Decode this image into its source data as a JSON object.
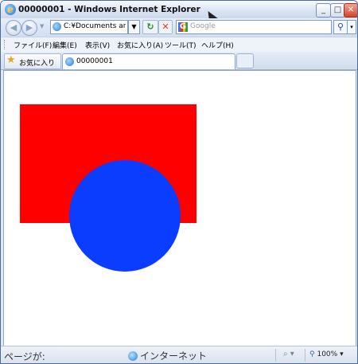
{
  "window": {
    "title": "00000001 - Windows Internet Explorer",
    "minimize_glyph": "_",
    "maximize_glyph": "□",
    "close_glyph": "✕"
  },
  "address_bar": {
    "url": "C:¥Documents and S",
    "dropdown_glyph": "▼",
    "refresh_glyph": "↻",
    "stop_glyph": "✕",
    "back_glyph": "◀",
    "forward_glyph": "▶"
  },
  "search": {
    "placeholder": "Google",
    "engine_logo_letter": "G",
    "button_glyph": "⚲",
    "dropdown_glyph": "▾"
  },
  "menu": {
    "items": [
      {
        "label": "ファイル(F)"
      },
      {
        "label": "編集(E)"
      },
      {
        "label": "表示(V)"
      },
      {
        "label": "お気に入り(A)"
      },
      {
        "label": "ツール(T)"
      },
      {
        "label": "ヘルプ(H)"
      }
    ]
  },
  "favorites": {
    "label": "お気に入り",
    "star_glyph": "★"
  },
  "tabs": [
    {
      "label": "00000001"
    }
  ],
  "content": {
    "rect_color": "#ff0000",
    "circle_color": "#0a3dff",
    "background_color": "#ffffff"
  },
  "statusbar": {
    "status_text": "ページが:",
    "zone_text": "インターネット",
    "protected_glyph": "⌕ ▾",
    "zoom_text": "100%",
    "zoom_icon": "magnifier-icon",
    "zoom_drop": "▾"
  },
  "colors": {
    "title_bar": "#dbe5f3",
    "close_button": "#d1462c",
    "accent_blue": "#2a77d4"
  }
}
